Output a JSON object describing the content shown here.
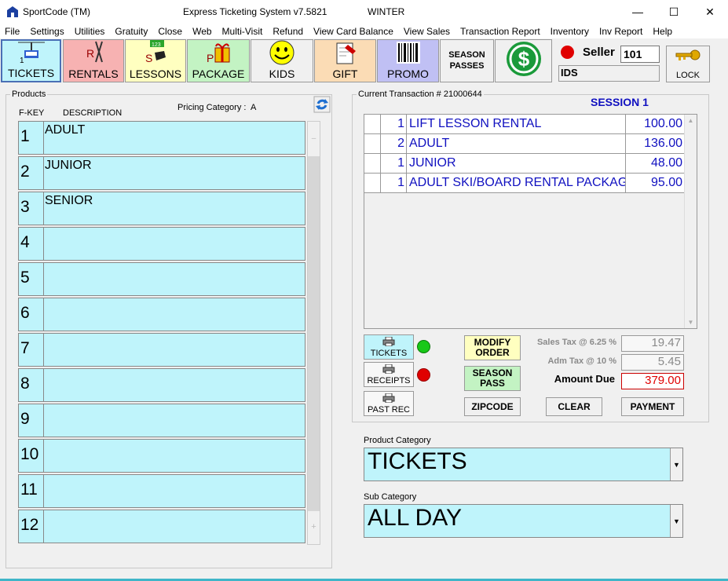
{
  "titlebar": {
    "app_name": "SportCode (TM)",
    "system_title": "Express Ticketing System v7.5821",
    "season": "WINTER",
    "minimize": "—",
    "maximize": "☐",
    "close": "✕"
  },
  "menu": [
    "File",
    "Settings",
    "Utilities",
    "Gratuity",
    "Close",
    "Web",
    "Multi-Visit",
    "Refund",
    "View Card Balance",
    "View Sales",
    "Transaction Report",
    "Inventory",
    "Inv Report",
    "Help"
  ],
  "toolbar": {
    "tickets": "TICKETS",
    "rentals": "RENTALS",
    "lessons": "LESSONS",
    "package": "PACKAGE",
    "kids": "KIDS",
    "gift": "GIFT",
    "promo": "PROMO",
    "season_passes_1": "SEASON",
    "season_passes_2": "PASSES",
    "seller_label": "Seller",
    "seller_id": "101",
    "seller_name": "IDS",
    "lock": "LOCK",
    "colors": {
      "tickets": "#bff4fb",
      "rentals": "#f7b2b2",
      "lessons": "#ffffc0",
      "package": "#c3f3c3",
      "kids": "#f0f0f0",
      "gift": "#fbdcb5",
      "promo": "#c0c0f4"
    }
  },
  "products": {
    "group_label": "Products",
    "fkey_header": "F-KEY",
    "desc_header": "DESCRIPTION",
    "pricing_label": "Pricing Category :",
    "pricing_value": "A",
    "rows": [
      {
        "key": "1",
        "desc": "ADULT"
      },
      {
        "key": "2",
        "desc": "JUNIOR"
      },
      {
        "key": "3",
        "desc": "SENIOR"
      },
      {
        "key": "4",
        "desc": ""
      },
      {
        "key": "5",
        "desc": ""
      },
      {
        "key": "6",
        "desc": ""
      },
      {
        "key": "7",
        "desc": ""
      },
      {
        "key": "8",
        "desc": ""
      },
      {
        "key": "9",
        "desc": ""
      },
      {
        "key": "10",
        "desc": ""
      },
      {
        "key": "11",
        "desc": ""
      },
      {
        "key": "12",
        "desc": ""
      }
    ]
  },
  "transaction": {
    "group_label": "Current Transaction # 21000644",
    "session": "SESSION 1",
    "rows": [
      {
        "qty": "1",
        "desc": "LIFT LESSON RENTAL",
        "price": "100.00"
      },
      {
        "qty": "2",
        "desc": "ADULT",
        "price": "136.00"
      },
      {
        "qty": "1",
        "desc": "JUNIOR",
        "price": "48.00"
      },
      {
        "qty": "1",
        "desc": "ADULT SKI/BOARD RENTAL PACKAGE",
        "price": "95.00"
      }
    ],
    "print_tickets": "TICKETS",
    "print_receipts": "RECEIPTS",
    "past_rec": "PAST REC",
    "modify_order_1": "MODIFY",
    "modify_order_2": "ORDER",
    "season_pass_1": "SEASON",
    "season_pass_2": "PASS",
    "zipcode": "ZIPCODE",
    "clear": "CLEAR",
    "payment": "PAYMENT",
    "sales_tax_label": "Sales Tax @ 6.25 %",
    "sales_tax": "19.47",
    "adm_tax_label": "Adm Tax @ 10 %",
    "adm_tax": "5.45",
    "amount_due_label": "Amount Due",
    "amount_due": "379.00"
  },
  "product_category": {
    "label": "Product Category",
    "value": "TICKETS"
  },
  "sub_category": {
    "label": "Sub Category",
    "value": "ALL DAY"
  }
}
